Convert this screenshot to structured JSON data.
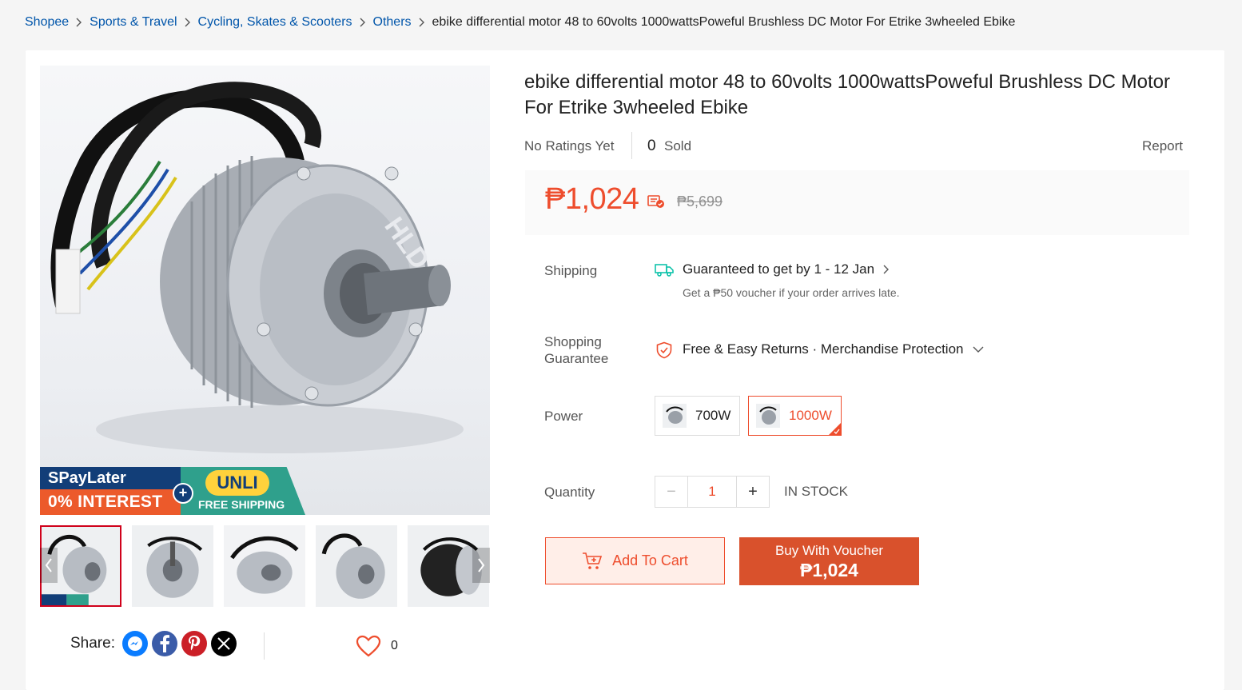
{
  "breadcrumb": {
    "items": [
      "Shopee",
      "Sports & Travel",
      "Cycling, Skates & Scooters",
      "Others"
    ],
    "current": "ebike differential motor 48 to 60volts 1000wattsPoweful Brushless DC Motor For Etrike 3wheeled Ebike"
  },
  "gallery": {
    "promo": {
      "spaylater": "SPayLater",
      "interest": "0% INTEREST",
      "plus": "+",
      "unli": "UNLI",
      "free_shipping": "FREE SHIPPING"
    },
    "motor_brand": "HLD",
    "thumbnail_count": 5,
    "active_thumbnail": 0
  },
  "share": {
    "label": "Share:",
    "icons": [
      "messenger-icon",
      "facebook-icon",
      "pinterest-icon",
      "x-icon"
    ]
  },
  "favorite": {
    "count": "0"
  },
  "product": {
    "title": "ebike differential motor 48 to 60volts 1000wattsPoweful Brushless DC Motor For Etrike 3wheeled Ebike",
    "ratings": "No Ratings Yet",
    "sold_count": "0",
    "sold_label": "Sold",
    "report": "Report",
    "price": "₱1,024",
    "original_price": "₱5,699"
  },
  "shipping": {
    "label": "Shipping",
    "guarantee": "Guaranteed to get by 1 - 12 Jan",
    "voucher_note": "Get a ₱50 voucher if your order arrives late."
  },
  "guarantee": {
    "label_line1": "Shopping",
    "label_line2": "Guarantee",
    "text": "Free & Easy Returns · Merchandise Protection"
  },
  "power": {
    "label": "Power",
    "options": [
      {
        "label": "700W",
        "selected": false
      },
      {
        "label": "1000W",
        "selected": true
      }
    ]
  },
  "quantity": {
    "label": "Quantity",
    "minus": "−",
    "plus": "+",
    "value": "1",
    "stock": "IN STOCK"
  },
  "actions": {
    "add_to_cart": "Add To Cart",
    "buy_voucher_label": "Buy With Voucher",
    "buy_voucher_price": "₱1,024"
  },
  "colors": {
    "accent": "#ee4d2d",
    "link": "#0055aa",
    "buy_button": "#d9512c"
  }
}
